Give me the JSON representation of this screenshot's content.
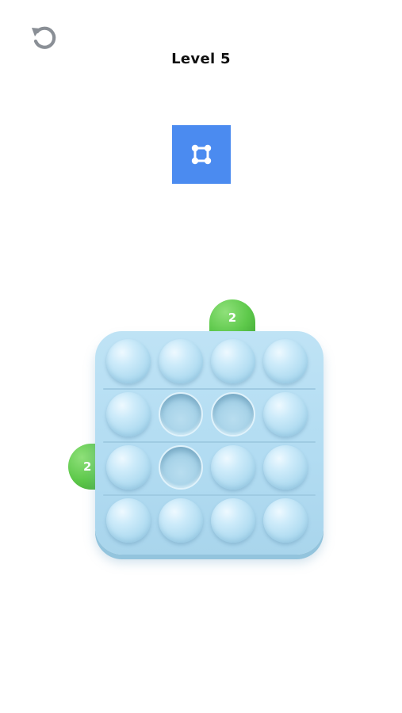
{
  "header": {
    "level_label": "Level 5",
    "restart_icon": "restart-icon"
  },
  "shape_card": {
    "icon": "square-nodes-icon",
    "color": "#4b8bf0"
  },
  "tabs": {
    "top_count": "2",
    "left_count": "2",
    "color": "#5ec94b"
  },
  "board": {
    "color": "#b2dcf2",
    "rows": 4,
    "cols": 4,
    "bubbles": [
      [
        "up",
        "up",
        "up",
        "up"
      ],
      [
        "up",
        "pressed",
        "pressed",
        "up"
      ],
      [
        "up",
        "pressed",
        "up",
        "up"
      ],
      [
        "up",
        "up",
        "up",
        "up"
      ]
    ]
  }
}
